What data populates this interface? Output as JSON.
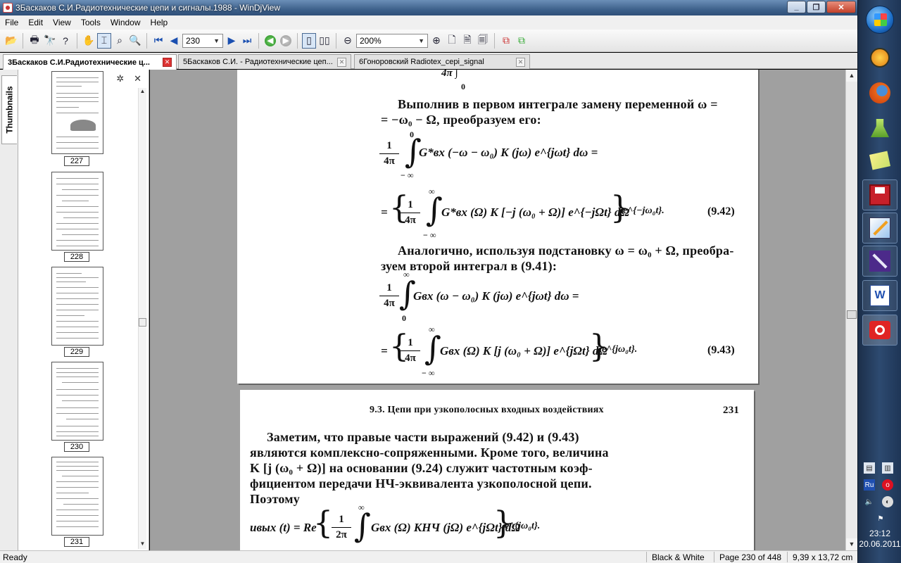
{
  "window": {
    "title": "3Баскаков С.И.Радиотехнические цепи и сигналы.1988 - WinDjView"
  },
  "menu": [
    "File",
    "Edit",
    "View",
    "Tools",
    "Window",
    "Help"
  ],
  "toolbar": {
    "page_value": "230",
    "zoom_value": "200%"
  },
  "tabs": [
    {
      "label": "3Баскаков С.И.Радиотехнические ц...",
      "active": true
    },
    {
      "label": "5Баскаков С.И. - Радиотехнические цеп...",
      "active": false
    },
    {
      "label": "6Гоноровский Radiotex_cepi_signal",
      "active": false
    }
  ],
  "sidebar": {
    "vertical_tab": "Thumbnails",
    "thumbnails": [
      {
        "page": "227"
      },
      {
        "page": "228"
      },
      {
        "page": "229"
      },
      {
        "page": "230"
      },
      {
        "page": "231"
      }
    ]
  },
  "page1": {
    "top_fragment": "4π ∫",
    "top_fragment_lim": "0",
    "para1_line1": "Выполнив в первом интеграле замену переменной ω =",
    "para1_line2": "= −ω₀ − Ω, преобразуем его:",
    "f1_num": "1",
    "f1_den": "4π",
    "f1_upper": "0",
    "f1_lower": "− ∞",
    "f1_body": "G*вх (−ω − ω₀) K (jω) e^{jωt} dω =",
    "f2_prefix": "=",
    "f2_num": "1",
    "f2_den": "4π",
    "f2_upper": "∞",
    "f2_lower": "− ∞",
    "f2_body": "G*вх (Ω) K [−j (ω₀ + Ω)] e^{−jΩt} dΩ",
    "f2_suffix": "e^{−jω₀t}.",
    "f2_eqno": "(9.42)",
    "para2_line1": "Аналогично, используя подстановку ω = ω₀ + Ω, преобра-",
    "para2_line2": "зуем второй интеграл в (9.41):",
    "f3_num": "1",
    "f3_den": "4π",
    "f3_upper": "∞",
    "f3_lower": "0",
    "f3_body": "Gвх (ω − ω₀) K (jω) e^{jωt} dω =",
    "f4_prefix": "=",
    "f4_num": "1",
    "f4_den": "4π",
    "f4_upper": "∞",
    "f4_lower": "− ∞",
    "f4_body": "Gвх (Ω) K [j (ω₀ + Ω)] e^{jΩt} dΩ",
    "f4_suffix": "e^{jω₀t}.",
    "f4_eqno": "(9.43)"
  },
  "page2": {
    "header": "9.3. Цепи при узкополосных входных воздействиях",
    "page_number": "231",
    "line1": "Заметим, что правые части выражений (9.42) и (9.43)",
    "line2": "являются комплексно-сопряженными. Кроме того, величина",
    "line3": "K [j (ω₀ + Ω)] на основании (9.24) служит частотным коэф-",
    "line4": "фициентом передачи НЧ-эквивалента узкополосной цепи.",
    "line5": "Поэтому",
    "f5_lhs": "uвых (t) = Re",
    "f5_num": "1",
    "f5_den": "2π",
    "f5_upper": "∞",
    "f5_body": "Gвх (Ω) KНЧ (jΩ) e^{jΩt} dΩ",
    "f5_suffix": "e^{jω₀t}."
  },
  "status": {
    "ready": "Ready",
    "mode": "Black & White",
    "page": "Page 230 of 448",
    "size": "9,39 x 13,72 cm"
  },
  "taskbar": {
    "language": "Ru",
    "time": "23:12",
    "date": "20.06.2011"
  },
  "colors": {
    "titlebar": "#3f628c",
    "doc_background": "#a0a0a0",
    "taskbar": "#2d4a70"
  }
}
